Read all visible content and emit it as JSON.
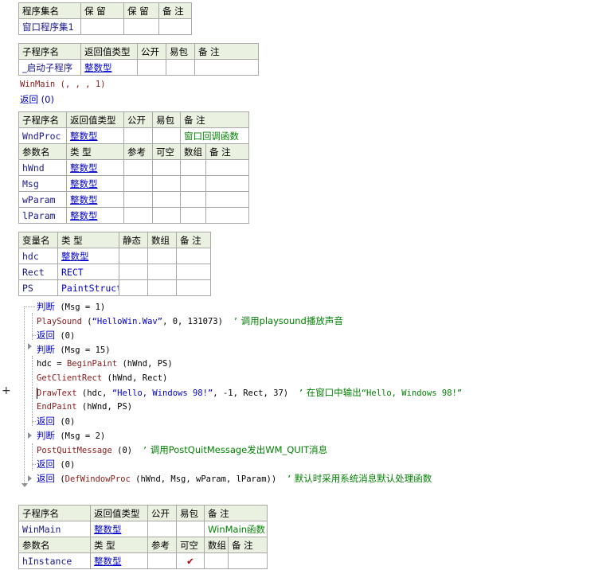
{
  "program_set": {
    "headers": [
      "程序集名",
      "保 留",
      "保 留",
      "备 注"
    ],
    "row": [
      "窗口程序集1",
      "",
      "",
      ""
    ]
  },
  "startup_sub": {
    "headers": [
      "子程序名",
      "返回值类型",
      "公开",
      "易包",
      "备 注"
    ],
    "row": [
      "_启动子程序",
      "整数型",
      "",
      "",
      ""
    ]
  },
  "startup_code": [
    "WinMain (, , , 1)",
    "返回 (0)"
  ],
  "wndproc": {
    "headers": [
      "子程序名",
      "返回值类型",
      "公开",
      "易包",
      "备 注"
    ],
    "row": [
      "WndProc",
      "整数型",
      "",
      "",
      "窗口回调函数"
    ],
    "param_headers": [
      "参数名",
      "类 型",
      "参考",
      "可空",
      "数组",
      "备 注"
    ],
    "params": [
      [
        "hWnd",
        "整数型"
      ],
      [
        "Msg",
        "整数型"
      ],
      [
        "wParam",
        "整数型"
      ],
      [
        "lParam",
        "整数型"
      ]
    ]
  },
  "locals": {
    "headers": [
      "变量名",
      "类 型",
      "静态",
      "数组",
      "备 注"
    ],
    "rows": [
      [
        "hdc",
        "整数型"
      ],
      [
        "Rect",
        "RECT"
      ],
      [
        "PS",
        "PaintStruct"
      ]
    ]
  },
  "code": {
    "l1_kw": "判断",
    "l1_rest": " (Msg = 1)",
    "l2_fn": "PlaySound",
    "l2_a": " (",
    "l2_str": "“HelloWin.Wav”",
    "l2_b": ", 0, 131073)  ",
    "l2_cq": "’",
    "l2_cmt": " 调用playsound播放声音",
    "l3_kw": "返回",
    "l3_rest": " (0)",
    "l4_kw": "判断",
    "l4_rest": " (Msg = 15)",
    "l5_a": "hdc = ",
    "l5_fn": "BeginPaint",
    "l5_b": " (hWnd, PS)",
    "l6_fn": "GetClientRect",
    "l6_b": " (hWnd, Rect)",
    "l7_fn": "DrawText",
    "l7_a": " (hdc, ",
    "l7_str": "“Hello, Windows 98!”",
    "l7_b": ", -1, Rect, 37)  ",
    "l7_cq": "’",
    "l7_cmt1": " 在窗口中输出",
    "l7_cmt2": "“Hello, Windows 98!”",
    "l8_fn": "EndPaint",
    "l8_b": " (hWnd, PS)",
    "l9_kw": "返回",
    "l9_rest": " (0)",
    "l10_kw": "判断",
    "l10_rest": " (Msg = 2)",
    "l11_fn": "PostQuitMessage",
    "l11_b": " (0)  ",
    "l11_cq": "’",
    "l11_cmt": " 调用PostQuitMessage发出WM_QUIT消息",
    "l12_kw": "返回",
    "l12_rest": " (0)",
    "l13_kw": "返回",
    "l13_a": " (",
    "l13_fn": "DefWindowProc",
    "l13_b": " (hWnd, Msg, wParam, lParam))  ",
    "l13_cq": "’",
    "l13_cmt": " 默认时采用系统消息默认处理函数"
  },
  "winmain": {
    "headers": [
      "子程序名",
      "返回值类型",
      "公开",
      "易包",
      "备 注"
    ],
    "row": [
      "WinMain",
      "整数型",
      "",
      "",
      "WinMain函数"
    ],
    "param_headers": [
      "参数名",
      "类 型",
      "参考",
      "可空",
      "数组",
      "备 注"
    ],
    "params": [
      [
        "hInstance",
        "整数型",
        "",
        "✔",
        "",
        ""
      ]
    ]
  }
}
